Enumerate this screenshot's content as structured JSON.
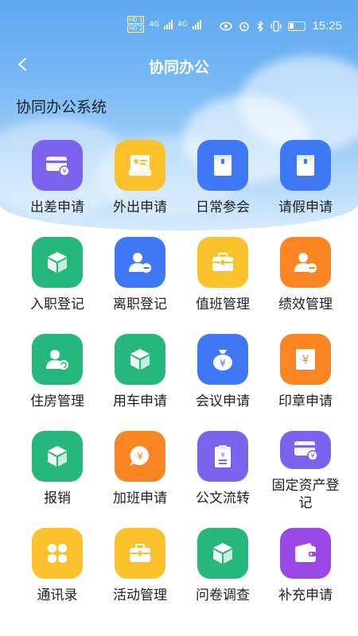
{
  "status_bar": {
    "sim1": "HD 1",
    "sim2": "HD 2",
    "net1": "4G",
    "net2": "4G",
    "time": "15:25"
  },
  "header": {
    "title": "协同办公",
    "subtitle": "协同办公系统"
  },
  "apps": [
    {
      "label": "出差申请",
      "icon": "card-yen-icon",
      "color": "#7c63ee"
    },
    {
      "label": "外出申请",
      "icon": "id-card-icon",
      "color": "#fbc22d"
    },
    {
      "label": "日常参会",
      "icon": "folder-icon",
      "color": "#3f78f4"
    },
    {
      "label": "请假申请",
      "icon": "folder-icon",
      "color": "#3f78f4"
    },
    {
      "label": "入职登记",
      "icon": "cube-icon",
      "color": "#26b77d"
    },
    {
      "label": "离职登记",
      "icon": "user-minus-icon",
      "color": "#3f78f4"
    },
    {
      "label": "值班管理",
      "icon": "briefcase-icon",
      "color": "#fbc22d"
    },
    {
      "label": "绩效管理",
      "icon": "user-minus-icon",
      "color": "#f98622"
    },
    {
      "label": "住房管理",
      "icon": "user-refresh-icon",
      "color": "#26b77d"
    },
    {
      "label": "用车申请",
      "icon": "cube-icon",
      "color": "#26b77d"
    },
    {
      "label": "会议申请",
      "icon": "money-bag-icon",
      "color": "#3f78f4"
    },
    {
      "label": "印章申请",
      "icon": "yen-square-icon",
      "color": "#f98622"
    },
    {
      "label": "报销",
      "icon": "cube-icon",
      "color": "#26b77d"
    },
    {
      "label": "加班申请",
      "icon": "yen-bubble-icon",
      "color": "#f98622"
    },
    {
      "label": "公文流转",
      "icon": "clipboard-icon",
      "color": "#7c63ee"
    },
    {
      "label": "固定资产登记",
      "icon": "card-yen-icon",
      "color": "#7c63ee"
    },
    {
      "label": "通讯录",
      "icon": "four-petal-icon",
      "color": "#fbc22d"
    },
    {
      "label": "活动管理",
      "icon": "briefcase-icon",
      "color": "#fbc22d"
    },
    {
      "label": "问卷调查",
      "icon": "cube-icon",
      "color": "#26b77d"
    },
    {
      "label": "补充申请",
      "icon": "wallet-icon",
      "color": "#9a48e6"
    }
  ]
}
